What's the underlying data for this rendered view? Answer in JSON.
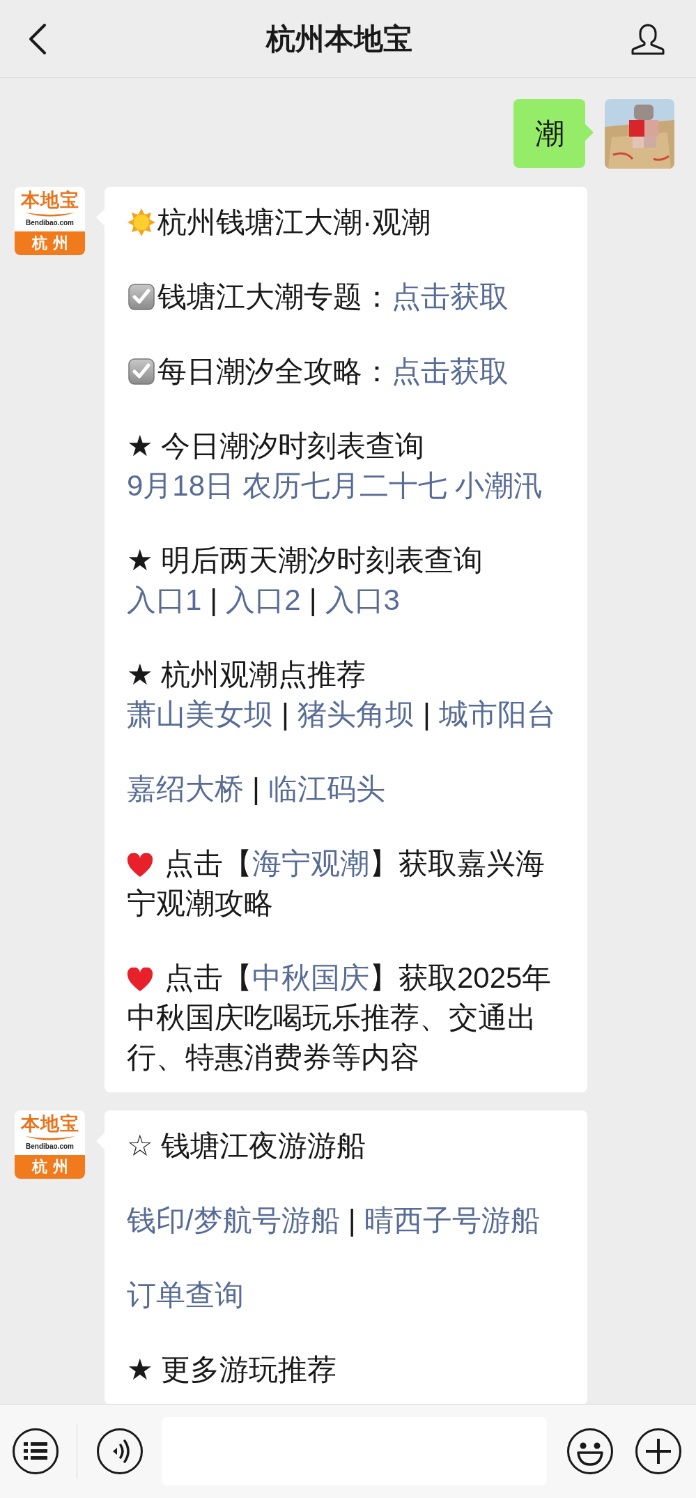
{
  "header": {
    "title": "杭州本地宝"
  },
  "messages": [
    {
      "kind": "sent",
      "text": "潮"
    },
    {
      "kind": "received",
      "logo": {
        "brand": "本地宝",
        "site": "Bendibao.com",
        "city": "杭州"
      },
      "paragraphs": [
        {
          "kind": "sun",
          "lines": [
            [
              {
                "kind": "text",
                "text": "杭州钱塘江大潮·观潮"
              }
            ]
          ]
        },
        {
          "kind": "check",
          "lines": [
            [
              {
                "kind": "text",
                "text": "钱塘江大潮专题："
              },
              {
                "kind": "link",
                "text": "点击获取"
              }
            ]
          ]
        },
        {
          "kind": "check",
          "lines": [
            [
              {
                "kind": "text",
                "text": "每日潮汐全攻略："
              },
              {
                "kind": "link",
                "text": "点击获取"
              }
            ]
          ]
        },
        {
          "lines": [
            [
              {
                "kind": "text",
                "text": "★ 今日潮汐时刻表查询"
              }
            ],
            [
              {
                "kind": "link",
                "text": "9月18日 农历七月二十七 小潮汛"
              }
            ]
          ]
        },
        {
          "lines": [
            [
              {
                "kind": "text",
                "text": "★ 明后两天潮汐时刻表查询"
              }
            ],
            [
              {
                "kind": "link",
                "text": "入口1"
              },
              {
                "kind": "sep",
                "text": "|"
              },
              {
                "kind": "link",
                "text": "入口2"
              },
              {
                "kind": "sep",
                "text": "|"
              },
              {
                "kind": "link",
                "text": "入口3"
              }
            ]
          ]
        },
        {
          "lines": [
            [
              {
                "kind": "text",
                "text": "★ 杭州观潮点推荐"
              }
            ],
            [
              {
                "kind": "link",
                "text": "萧山美女坝"
              },
              {
                "kind": "sep",
                "text": "|"
              },
              {
                "kind": "link",
                "text": "猪头角坝"
              },
              {
                "kind": "sep",
                "text": "|"
              },
              {
                "kind": "link",
                "text": "城市阳台"
              }
            ]
          ]
        },
        {
          "lines": [
            [
              {
                "kind": "link",
                "text": "嘉绍大桥"
              },
              {
                "kind": "sep",
                "text": "|"
              },
              {
                "kind": "link",
                "text": "临江码头"
              }
            ]
          ]
        },
        {
          "kind": "heart",
          "lines": [
            [
              {
                "kind": "text",
                "text": "点击【"
              },
              {
                "kind": "link",
                "text": "海宁观潮"
              },
              {
                "kind": "text",
                "text": "】获取嘉兴海宁观潮攻略"
              }
            ]
          ]
        },
        {
          "kind": "heart",
          "lines": [
            [
              {
                "kind": "text",
                "text": "点击【"
              },
              {
                "kind": "link",
                "text": "中秋国庆"
              },
              {
                "kind": "text",
                "text": "】获取2025年中秋国庆吃喝玩乐推荐、交通出行、特惠消费券等内容"
              }
            ]
          ]
        }
      ]
    },
    {
      "kind": "received",
      "logo": {
        "brand": "本地宝",
        "site": "Bendibao.com",
        "city": "杭州"
      },
      "paragraphs": [
        {
          "lines": [
            [
              {
                "kind": "text",
                "text": "☆ 钱塘江夜游游船"
              }
            ]
          ]
        },
        {
          "lines": [
            [
              {
                "kind": "link",
                "text": "钱印/梦航号游船"
              },
              {
                "kind": "sep",
                "text": "|"
              },
              {
                "kind": "link",
                "text": "晴西子号游船"
              }
            ]
          ]
        },
        {
          "lines": [
            [
              {
                "kind": "link",
                "text": "订单查询"
              }
            ]
          ]
        },
        {
          "lines": [
            [
              {
                "kind": "text",
                "text": "★ 更多游玩推荐"
              }
            ]
          ]
        }
      ]
    }
  ]
}
